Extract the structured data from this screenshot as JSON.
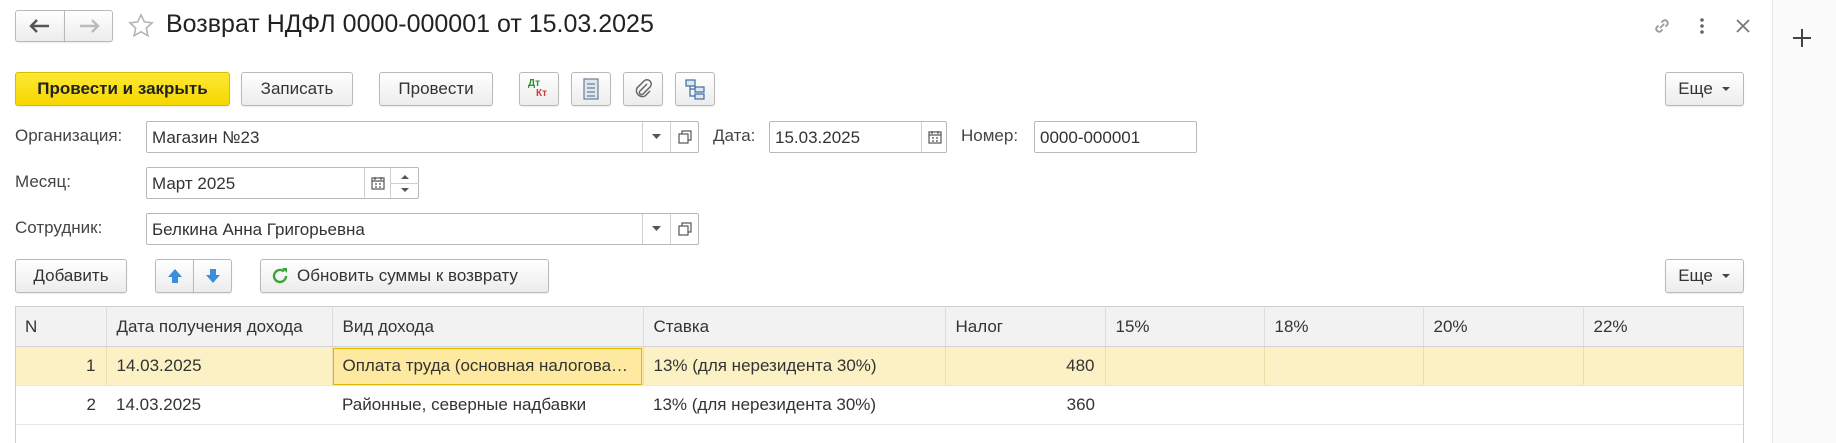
{
  "window": {
    "title": "Возврат НДФЛ 0000-000001 от 15.03.2025"
  },
  "toolbar": {
    "post_close": "Провести и закрыть",
    "save": "Записать",
    "post": "Провести",
    "dt_label": "Дт",
    "kt_label": "Кт",
    "more": "Еще"
  },
  "form": {
    "org_label": "Организация:",
    "org_value": "Магазин №23",
    "date_label": "Дата:",
    "date_value": "15.03.2025",
    "number_label": "Номер:",
    "number_value": "0000-000001",
    "month_label": "Месяц:",
    "month_value": "Март 2025",
    "employee_label": "Сотрудник:",
    "employee_value": "Белкина Анна Григорьевна"
  },
  "table_toolbar": {
    "add": "Добавить",
    "refresh": "Обновить суммы к возврату",
    "more": "Еще"
  },
  "table": {
    "columns": [
      "N",
      "Дата получения дохода",
      "Вид дохода",
      "Ставка",
      "Налог",
      "15%",
      "18%",
      "20%",
      "22%"
    ],
    "rows": [
      {
        "n": "1",
        "date": "14.03.2025",
        "income": "Оплата труда (основная налоговая база)",
        "rate": "13% (для нерезидента 30%)",
        "tax": "480"
      },
      {
        "n": "2",
        "date": "14.03.2025",
        "income": "Районные, северные надбавки",
        "rate": "13% (для нерезидента 30%)",
        "tax": "360"
      }
    ]
  },
  "colors": {
    "primary_button": "#f5d700",
    "selected_row": "#fbf1c4",
    "accent_blue": "#3b8fd9",
    "refresh_green": "#3aa53a"
  }
}
